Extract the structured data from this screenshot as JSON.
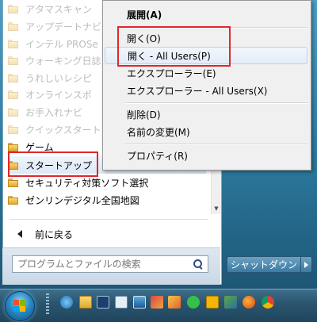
{
  "programs": [
    {
      "label": "アタマスキャン",
      "faded": true
    },
    {
      "label": "アップデートナビ",
      "faded": true
    },
    {
      "label": "インテル PROSe",
      "faded": true
    },
    {
      "label": "ウォーキング日誌",
      "faded": true
    },
    {
      "label": "うれしいレシピ",
      "faded": true
    },
    {
      "label": "オンラインスポ",
      "faded": true
    },
    {
      "label": "お手入れナビ",
      "faded": true
    },
    {
      "label": "クイックスタート",
      "faded": true
    },
    {
      "label": "ゲーム",
      "faded": false
    },
    {
      "label": "スタートアップ",
      "faded": false,
      "selected": true
    },
    {
      "label": "セキュリティ対策ソフト選択",
      "faded": false
    },
    {
      "label": "ゼンリンデジタル全国地図",
      "faded": false
    }
  ],
  "back_label": "前に戻る",
  "search": {
    "placeholder": "プログラムとファイルの検索"
  },
  "shutdown_label": "シャットダウン",
  "context_menu": {
    "expand": "展開(A)",
    "open": "開く(O)",
    "open_all_users": "開く - All Users(P)",
    "explorer": "エクスプローラー(E)",
    "explorer_all_users": "エクスプローラー - All Users(X)",
    "delete": "削除(D)",
    "rename": "名前の変更(M)",
    "properties": "プロパティ(R)"
  },
  "colors": {
    "highlight_red": "#e0262e",
    "taskbar": "#2b5670"
  },
  "taskbar_icons": [
    "ie-icon",
    "explorer-icon",
    "media-icon",
    "calculator-icon",
    "screen-icon",
    "photo-icon",
    "paint-icon",
    "chat-icon",
    "notes-icon",
    "games-icon",
    "firefox-icon",
    "chrome-icon"
  ]
}
